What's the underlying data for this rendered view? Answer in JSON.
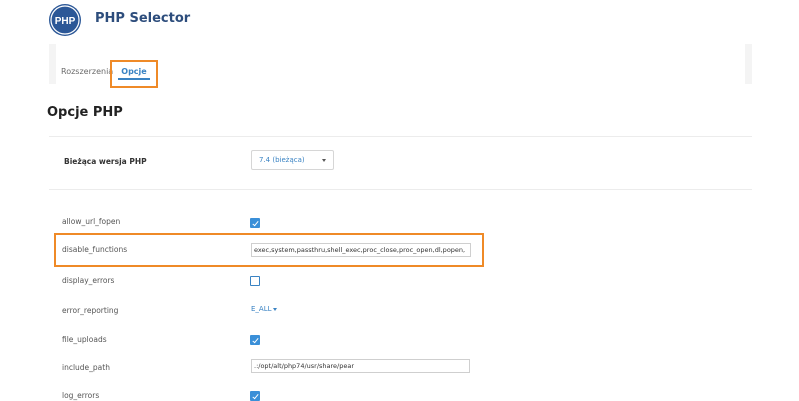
{
  "header": {
    "logo_text": "PHP",
    "title": "PHP Selector"
  },
  "tabs": [
    {
      "label": "Rozszerzenia",
      "active": false
    },
    {
      "label": "Opcje",
      "active": true
    }
  ],
  "section_title": "Opcje PHP",
  "php_version": {
    "label": "Bieżąca wersja PHP",
    "selected": "7.4 (bieżąca)"
  },
  "options": [
    {
      "name": "allow_url_fopen",
      "type": "checkbox",
      "checked": true
    },
    {
      "name": "disable_functions",
      "type": "text",
      "value": "exec,system,passthru,shell_exec,proc_close,proc_open,dl,popen,"
    },
    {
      "name": "display_errors",
      "type": "checkbox",
      "checked": false
    },
    {
      "name": "error_reporting",
      "type": "dropdown",
      "value": "E_ALL"
    },
    {
      "name": "file_uploads",
      "type": "checkbox",
      "checked": true
    },
    {
      "name": "include_path",
      "type": "text",
      "value": ".:/opt/alt/php74/usr/share/pear"
    },
    {
      "name": "log_errors",
      "type": "checkbox",
      "checked": true
    }
  ],
  "colors": {
    "accent": "#3a83c3",
    "highlight": "#ef8a27",
    "brand": "#2b5797"
  }
}
